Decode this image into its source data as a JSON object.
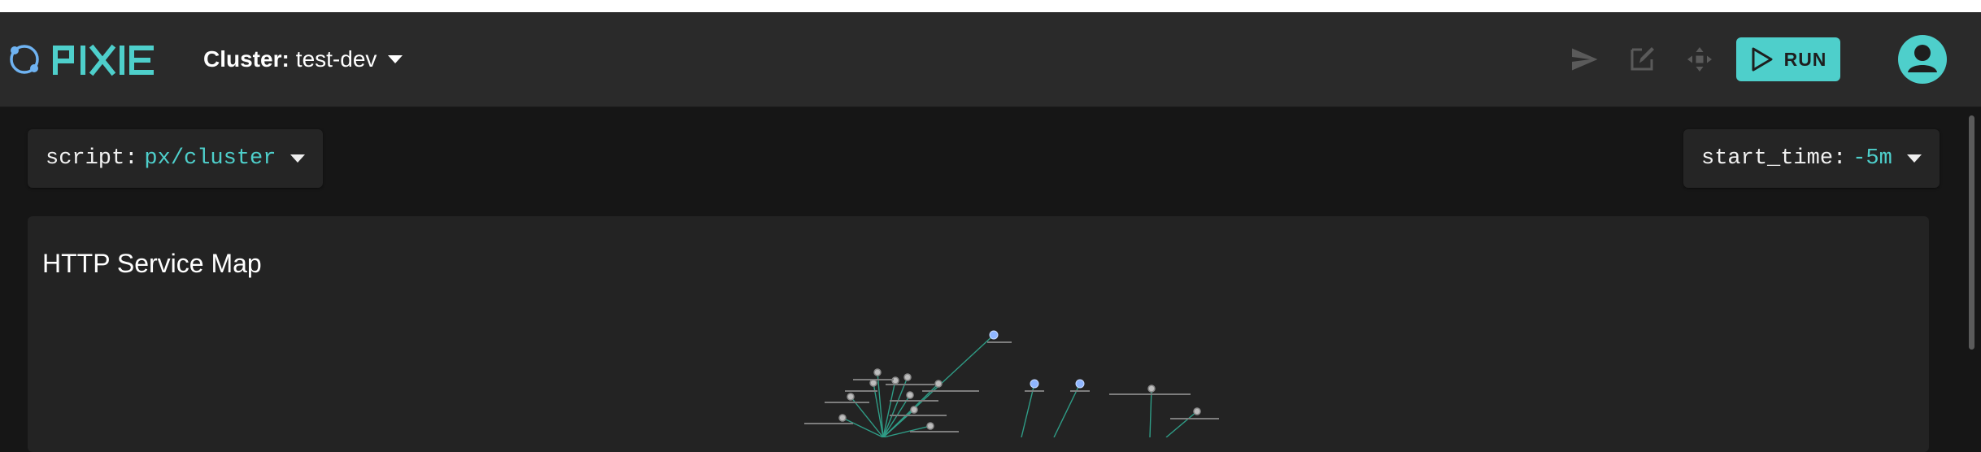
{
  "brand": {
    "logo_text": "PIXIE"
  },
  "header": {
    "cluster_label": "Cluster:",
    "cluster_value": "test-dev",
    "run_label": "RUN"
  },
  "toolbar": {
    "icons": [
      "send-icon",
      "edit-icon",
      "move-icon",
      "play-icon",
      "user-avatar-icon"
    ]
  },
  "script_selector": {
    "key": "script:",
    "value": "px/cluster"
  },
  "time_selector": {
    "key": "start_time:",
    "value": "-5m"
  },
  "panel": {
    "title": "HTTP Service Map"
  },
  "colors": {
    "accent": "#4ecfcb",
    "appbar": "#2a2a2a",
    "background": "#161616",
    "card": "#232323",
    "node_service": "#b5b5b5",
    "node_external": "#8fb6ff",
    "edge": "#2f9c86"
  }
}
